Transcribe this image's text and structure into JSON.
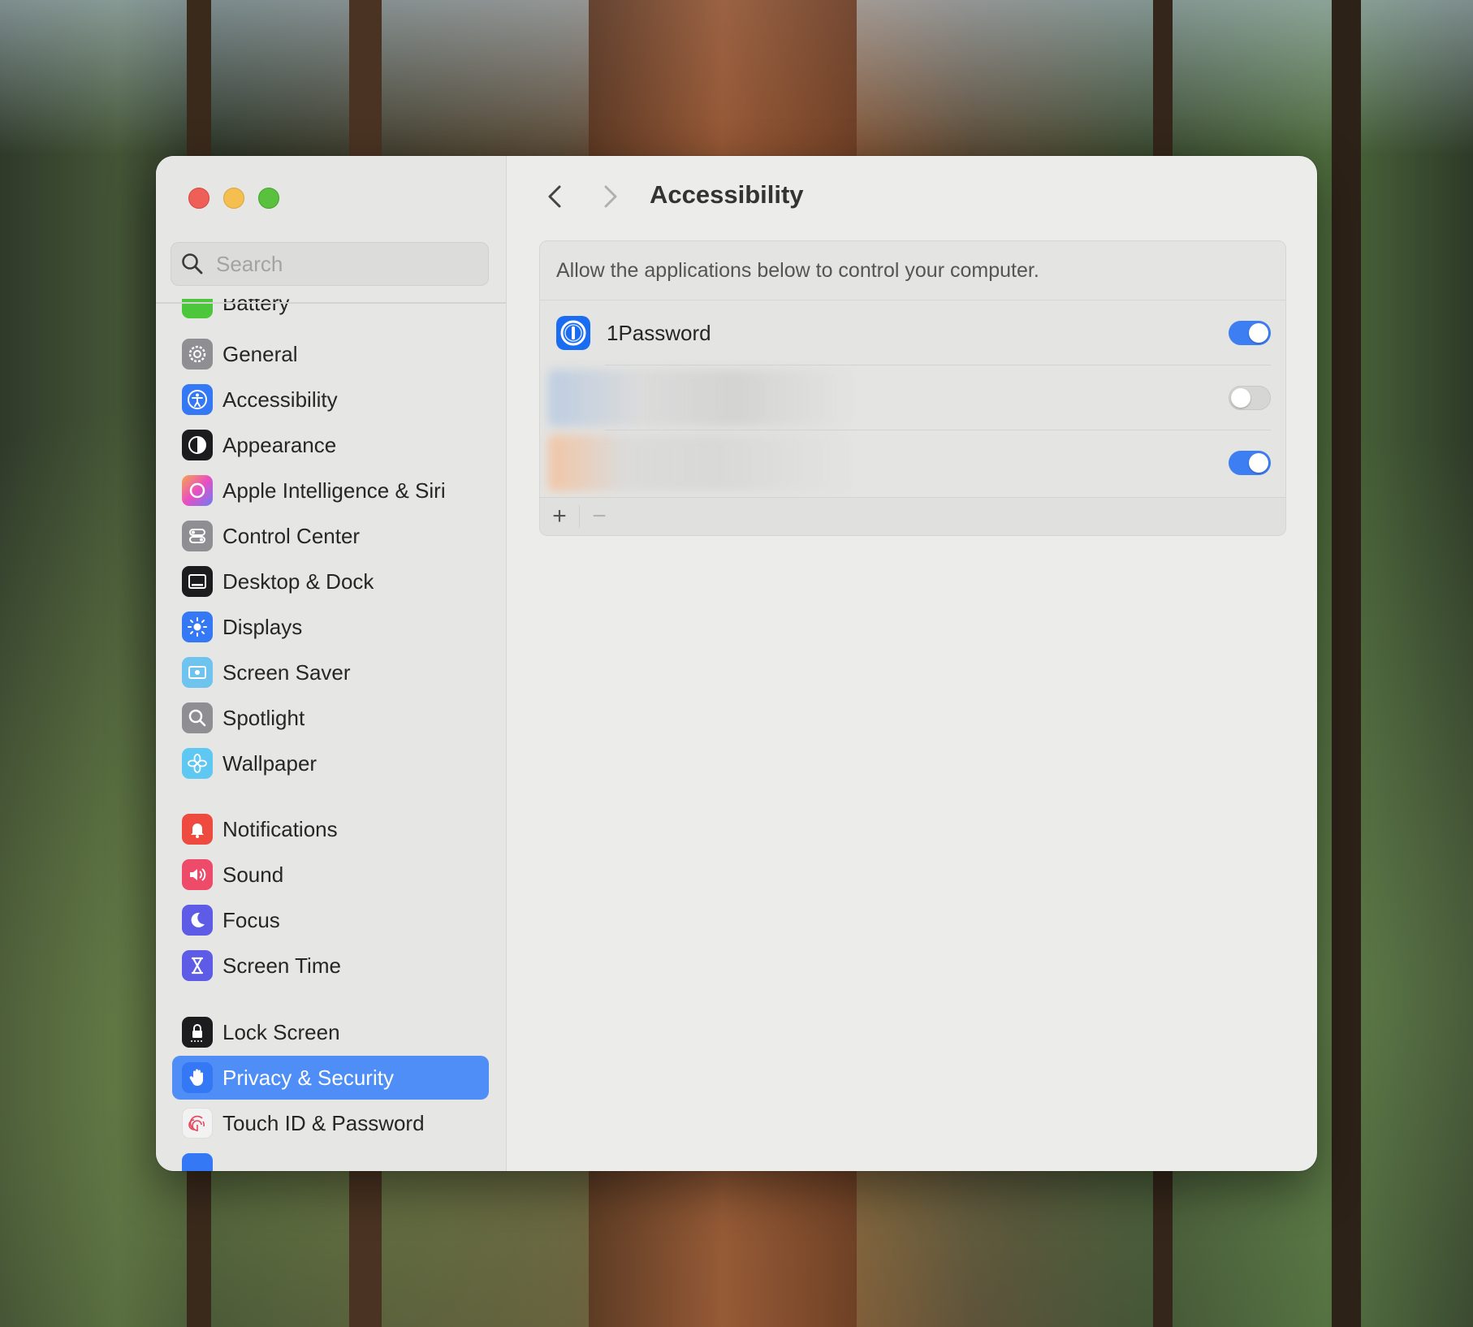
{
  "window": {
    "title": "Accessibility"
  },
  "sidebar": {
    "search_placeholder": "Search",
    "items": [
      {
        "label": "Battery",
        "icon": "battery-icon",
        "color": "#4cc63a"
      },
      {
        "label": "General",
        "icon": "gear-icon",
        "color": "#8e8e93"
      },
      {
        "label": "Accessibility",
        "icon": "accessibility-icon",
        "color": "#3478f6"
      },
      {
        "label": "Appearance",
        "icon": "appearance-icon",
        "color": "#1c1c1e"
      },
      {
        "label": "Apple Intelligence & Siri",
        "icon": "siri-icon",
        "color": "#e87bd0"
      },
      {
        "label": "Control Center",
        "icon": "control-center-icon",
        "color": "#8e8e93"
      },
      {
        "label": "Desktop & Dock",
        "icon": "desktop-dock-icon",
        "color": "#1c1c1e"
      },
      {
        "label": "Displays",
        "icon": "displays-icon",
        "color": "#3478f6"
      },
      {
        "label": "Screen Saver",
        "icon": "screen-saver-icon",
        "color": "#6fc3ef"
      },
      {
        "label": "Spotlight",
        "icon": "spotlight-icon",
        "color": "#8e8e93"
      },
      {
        "label": "Wallpaper",
        "icon": "wallpaper-icon",
        "color": "#5ec8f2"
      },
      {
        "label": "Notifications",
        "icon": "notifications-icon",
        "color": "#ef4a3f"
      },
      {
        "label": "Sound",
        "icon": "sound-icon",
        "color": "#ee4b6a"
      },
      {
        "label": "Focus",
        "icon": "focus-icon",
        "color": "#5e5ce6"
      },
      {
        "label": "Screen Time",
        "icon": "screen-time-icon",
        "color": "#5e5ce6"
      },
      {
        "label": "Lock Screen",
        "icon": "lock-screen-icon",
        "color": "#1c1c1e"
      },
      {
        "label": "Privacy & Security",
        "icon": "privacy-hand-icon",
        "color": "#3478f6",
        "selected": true
      },
      {
        "label": "Touch ID & Password",
        "icon": "touch-id-icon",
        "color": "#f2f2f2"
      }
    ]
  },
  "main": {
    "description": "Allow the applications below to control your computer.",
    "apps": [
      {
        "name": "1Password",
        "enabled": true,
        "icon": "1password-icon"
      },
      {
        "name": "",
        "enabled": false,
        "icon": "blurred-app-icon"
      },
      {
        "name": "",
        "enabled": true,
        "icon": "blurred-app-icon"
      }
    ],
    "add_label": "+",
    "remove_label": "−"
  },
  "colors": {
    "accent": "#3e7ef3",
    "selection": "#4f8ef7"
  }
}
